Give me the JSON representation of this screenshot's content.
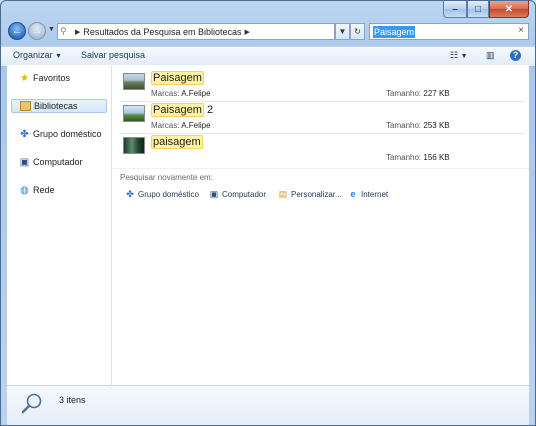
{
  "window": {
    "minimize": "–",
    "maximize": "□",
    "close": "✕"
  },
  "navbar": {
    "back": "←",
    "forward": "→",
    "address": "Resultados da Pesquisa em Bibliotecas",
    "search_value": "Paisagem"
  },
  "toolbar": {
    "organize": "Organizar",
    "save_search": "Salvar pesquisa"
  },
  "sidebar": {
    "items": [
      {
        "label": "Favoritos",
        "icon": "star-icon"
      },
      {
        "label": "Bibliotecas",
        "icon": "library-icon",
        "selected": true
      },
      {
        "label": "Grupo doméstico",
        "icon": "homegroup-icon"
      },
      {
        "label": "Computador",
        "icon": "computer-icon"
      },
      {
        "label": "Rede",
        "icon": "network-icon"
      }
    ]
  },
  "results": [
    {
      "match": "Paisagem",
      "rest": "",
      "tags_label": "Marcas:",
      "tags": "A.Felipe",
      "size_label": "Tamanho:",
      "size": "227 KB"
    },
    {
      "match": "Paisagem",
      "rest": " 2",
      "tags_label": "Marcas:",
      "tags": "A.Felipe",
      "size_label": "Tamanho:",
      "size": "253 KB"
    },
    {
      "match": "paisagem",
      "rest": "",
      "tags_label": "",
      "tags": "",
      "size_label": "Tamanho:",
      "size": "156 KB"
    }
  ],
  "search_again": {
    "label": "Pesquisar novamente em:",
    "options": [
      {
        "label": "Grupo doméstico",
        "icon": "homegroup-icon"
      },
      {
        "label": "Computador",
        "icon": "computer-icon"
      },
      {
        "label": "Personalizar...",
        "icon": "folder-search-icon"
      },
      {
        "label": "Internet",
        "icon": "internet-explorer-icon"
      }
    ]
  },
  "status": {
    "count": "3 itens"
  },
  "colors": {
    "highlight": "#fff4a3",
    "selection": "#3399ff",
    "accent": "#1e395b"
  }
}
